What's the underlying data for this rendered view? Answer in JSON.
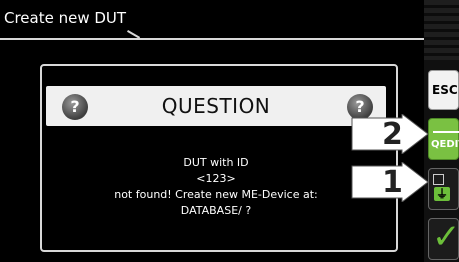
{
  "window": {
    "title": "Create new DUT"
  },
  "softkeys": {
    "esc": "ESC",
    "qedit": "QEDIT",
    "dev_icon": "ground-symbol-icon",
    "ok_icon": "checkmark-icon"
  },
  "dialog": {
    "title": "QUESTION",
    "icon": "question-icon",
    "icon_glyph": "?",
    "message": [
      "DUT with ID",
      "<123>",
      "not found! Create new ME-Device at:",
      "DATABASE/ ?"
    ]
  },
  "callouts": [
    {
      "label": "2",
      "target": "qedit"
    },
    {
      "label": "1",
      "target": "device"
    }
  ],
  "colors": {
    "accent_green": "#7ac142",
    "header_bg": "#f0f0f0",
    "background": "#000000"
  }
}
